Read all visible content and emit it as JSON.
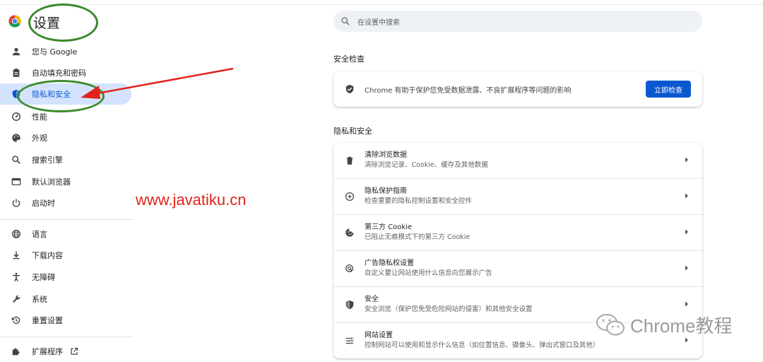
{
  "app": {
    "title": "设置"
  },
  "sidebar": {
    "items": [
      {
        "label": "您与 Google",
        "icon": "person-icon"
      },
      {
        "label": "自动填充和密码",
        "icon": "clipboard-icon"
      },
      {
        "label": "隐私和安全",
        "icon": "shield-icon",
        "active": true
      },
      {
        "label": "性能",
        "icon": "speedometer-icon"
      },
      {
        "label": "外观",
        "icon": "palette-icon"
      },
      {
        "label": "搜索引擎",
        "icon": "search-icon"
      },
      {
        "label": "默认浏览器",
        "icon": "browser-icon"
      },
      {
        "label": "启动时",
        "icon": "power-icon"
      },
      {
        "label": "语言",
        "icon": "globe-icon"
      },
      {
        "label": "下载内容",
        "icon": "download-icon"
      },
      {
        "label": "无障碍",
        "icon": "accessibility-icon"
      },
      {
        "label": "系统",
        "icon": "wrench-icon"
      },
      {
        "label": "重置设置",
        "icon": "history-icon"
      },
      {
        "label": "扩展程序",
        "icon": "puzzle-icon"
      }
    ]
  },
  "search": {
    "placeholder": "在设置中搜索"
  },
  "safety_check": {
    "section_title": "安全检查",
    "description": "Chrome 有助于保护您免受数据泄露、不良扩展程序等问题的影响",
    "button_label": "立即检查"
  },
  "privacy": {
    "section_title": "隐私和安全",
    "rows": [
      {
        "title": "清除浏览数据",
        "subtitle": "清除浏览记录、Cookie、缓存及其他数据",
        "icon": "trash-icon"
      },
      {
        "title": "隐私保护指南",
        "subtitle": "检查重要的隐私控制设置和安全控件",
        "icon": "compass-icon"
      },
      {
        "title": "第三方 Cookie",
        "subtitle": "已阻止无痕模式下的第三方 Cookie",
        "icon": "cookie-icon"
      },
      {
        "title": "广告隐私权设置",
        "subtitle": "自定义要让网站使用什么信息向您展示广告",
        "icon": "ad-privacy-icon"
      },
      {
        "title": "安全",
        "subtitle": "安全浏览（保护您免受危险网站的侵害）和其他安全设置",
        "icon": "security-shield-icon"
      },
      {
        "title": "网站设置",
        "subtitle": "控制网站可以使用和显示什么信息（如位置信息、摄像头、弹出式窗口及其他）",
        "icon": "tune-icon"
      }
    ]
  },
  "annotations": {
    "watermark_url": "www.javatiku.cn",
    "wechat_watermark": "Chrome教程",
    "highlight_color": "#3b8a2c",
    "arrow_color": "#e0241b"
  },
  "colors": {
    "accent": "#0b57d0",
    "active_bg": "#d3e3fd"
  }
}
